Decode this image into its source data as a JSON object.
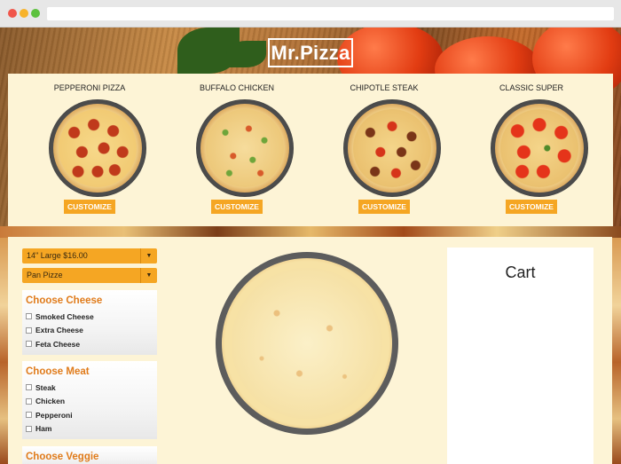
{
  "app": {
    "logo": "Mr.Pizza"
  },
  "menu": {
    "items": [
      {
        "name": "PEPPERONI PIZZA",
        "button": "CUSTOMIZE"
      },
      {
        "name": "BUFFALO CHICKEN",
        "button": "CUSTOMIZE"
      },
      {
        "name": "CHIPOTLE STEAK",
        "button": "CUSTOMIZE"
      },
      {
        "name": "CLASSIC SUPER",
        "button": "CUSTOMIZE"
      }
    ]
  },
  "builder": {
    "size_select": "14\" Large $16.00",
    "crust_select": "Pan Pizze",
    "cheese": {
      "title": "Choose Cheese",
      "options": [
        "Smoked Cheese",
        "Extra Cheese",
        "Feta Cheese"
      ]
    },
    "meat": {
      "title": "Choose Meat",
      "options": [
        "Steak",
        "Chicken",
        "Pepperoni",
        "Ham"
      ]
    },
    "veggie": {
      "title": "Choose Veggie"
    }
  },
  "cart": {
    "title": "Cart"
  },
  "colors": {
    "accent": "#f5a623",
    "panel": "#fdf4d6",
    "option_title": "#e07b1a"
  }
}
